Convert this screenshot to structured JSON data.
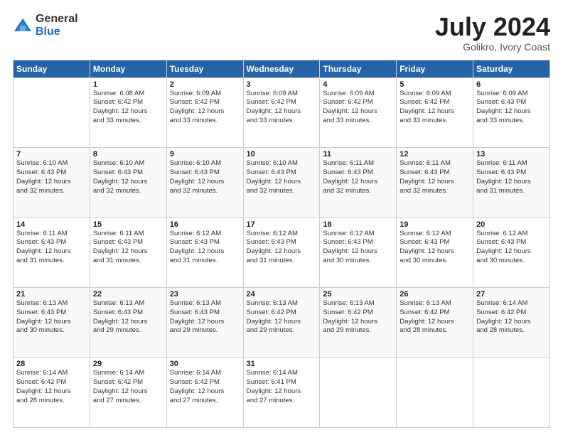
{
  "header": {
    "logo_general": "General",
    "logo_blue": "Blue",
    "month_title": "July 2024",
    "location": "Golikro, Ivory Coast"
  },
  "days_of_week": [
    "Sunday",
    "Monday",
    "Tuesday",
    "Wednesday",
    "Thursday",
    "Friday",
    "Saturday"
  ],
  "weeks": [
    [
      {
        "day": "",
        "info": ""
      },
      {
        "day": "1",
        "info": "Sunrise: 6:08 AM\nSunset: 6:42 PM\nDaylight: 12 hours\nand 33 minutes."
      },
      {
        "day": "2",
        "info": "Sunrise: 6:09 AM\nSunset: 6:42 PM\nDaylight: 12 hours\nand 33 minutes."
      },
      {
        "day": "3",
        "info": "Sunrise: 6:09 AM\nSunset: 6:42 PM\nDaylight: 12 hours\nand 33 minutes."
      },
      {
        "day": "4",
        "info": "Sunrise: 6:09 AM\nSunset: 6:42 PM\nDaylight: 12 hours\nand 33 minutes."
      },
      {
        "day": "5",
        "info": "Sunrise: 6:09 AM\nSunset: 6:42 PM\nDaylight: 12 hours\nand 33 minutes."
      },
      {
        "day": "6",
        "info": "Sunrise: 6:09 AM\nSunset: 6:43 PM\nDaylight: 12 hours\nand 33 minutes."
      }
    ],
    [
      {
        "day": "7",
        "info": "Sunrise: 6:10 AM\nSunset: 6:43 PM\nDaylight: 12 hours\nand 32 minutes."
      },
      {
        "day": "8",
        "info": "Sunrise: 6:10 AM\nSunset: 6:43 PM\nDaylight: 12 hours\nand 32 minutes."
      },
      {
        "day": "9",
        "info": "Sunrise: 6:10 AM\nSunset: 6:43 PM\nDaylight: 12 hours\nand 32 minutes."
      },
      {
        "day": "10",
        "info": "Sunrise: 6:10 AM\nSunset: 6:43 PM\nDaylight: 12 hours\nand 32 minutes."
      },
      {
        "day": "11",
        "info": "Sunrise: 6:11 AM\nSunset: 6:43 PM\nDaylight: 12 hours\nand 32 minutes."
      },
      {
        "day": "12",
        "info": "Sunrise: 6:11 AM\nSunset: 6:43 PM\nDaylight: 12 hours\nand 32 minutes."
      },
      {
        "day": "13",
        "info": "Sunrise: 6:11 AM\nSunset: 6:43 PM\nDaylight: 12 hours\nand 31 minutes."
      }
    ],
    [
      {
        "day": "14",
        "info": "Sunrise: 6:11 AM\nSunset: 6:43 PM\nDaylight: 12 hours\nand 31 minutes."
      },
      {
        "day": "15",
        "info": "Sunrise: 6:11 AM\nSunset: 6:43 PM\nDaylight: 12 hours\nand 31 minutes."
      },
      {
        "day": "16",
        "info": "Sunrise: 6:12 AM\nSunset: 6:43 PM\nDaylight: 12 hours\nand 31 minutes."
      },
      {
        "day": "17",
        "info": "Sunrise: 6:12 AM\nSunset: 6:43 PM\nDaylight: 12 hours\nand 31 minutes."
      },
      {
        "day": "18",
        "info": "Sunrise: 6:12 AM\nSunset: 6:43 PM\nDaylight: 12 hours\nand 30 minutes."
      },
      {
        "day": "19",
        "info": "Sunrise: 6:12 AM\nSunset: 6:43 PM\nDaylight: 12 hours\nand 30 minutes."
      },
      {
        "day": "20",
        "info": "Sunrise: 6:12 AM\nSunset: 6:43 PM\nDaylight: 12 hours\nand 30 minutes."
      }
    ],
    [
      {
        "day": "21",
        "info": "Sunrise: 6:13 AM\nSunset: 6:43 PM\nDaylight: 12 hours\nand 30 minutes."
      },
      {
        "day": "22",
        "info": "Sunrise: 6:13 AM\nSunset: 6:43 PM\nDaylight: 12 hours\nand 29 minutes."
      },
      {
        "day": "23",
        "info": "Sunrise: 6:13 AM\nSunset: 6:43 PM\nDaylight: 12 hours\nand 29 minutes."
      },
      {
        "day": "24",
        "info": "Sunrise: 6:13 AM\nSunset: 6:42 PM\nDaylight: 12 hours\nand 29 minutes."
      },
      {
        "day": "25",
        "info": "Sunrise: 6:13 AM\nSunset: 6:42 PM\nDaylight: 12 hours\nand 29 minutes."
      },
      {
        "day": "26",
        "info": "Sunrise: 6:13 AM\nSunset: 6:42 PM\nDaylight: 12 hours\nand 28 minutes."
      },
      {
        "day": "27",
        "info": "Sunrise: 6:14 AM\nSunset: 6:42 PM\nDaylight: 12 hours\nand 28 minutes."
      }
    ],
    [
      {
        "day": "28",
        "info": "Sunrise: 6:14 AM\nSunset: 6:42 PM\nDaylight: 12 hours\nand 28 minutes."
      },
      {
        "day": "29",
        "info": "Sunrise: 6:14 AM\nSunset: 6:42 PM\nDaylight: 12 hours\nand 27 minutes."
      },
      {
        "day": "30",
        "info": "Sunrise: 6:14 AM\nSunset: 6:42 PM\nDaylight: 12 hours\nand 27 minutes."
      },
      {
        "day": "31",
        "info": "Sunrise: 6:14 AM\nSunset: 6:41 PM\nDaylight: 12 hours\nand 27 minutes."
      },
      {
        "day": "",
        "info": ""
      },
      {
        "day": "",
        "info": ""
      },
      {
        "day": "",
        "info": ""
      }
    ]
  ]
}
